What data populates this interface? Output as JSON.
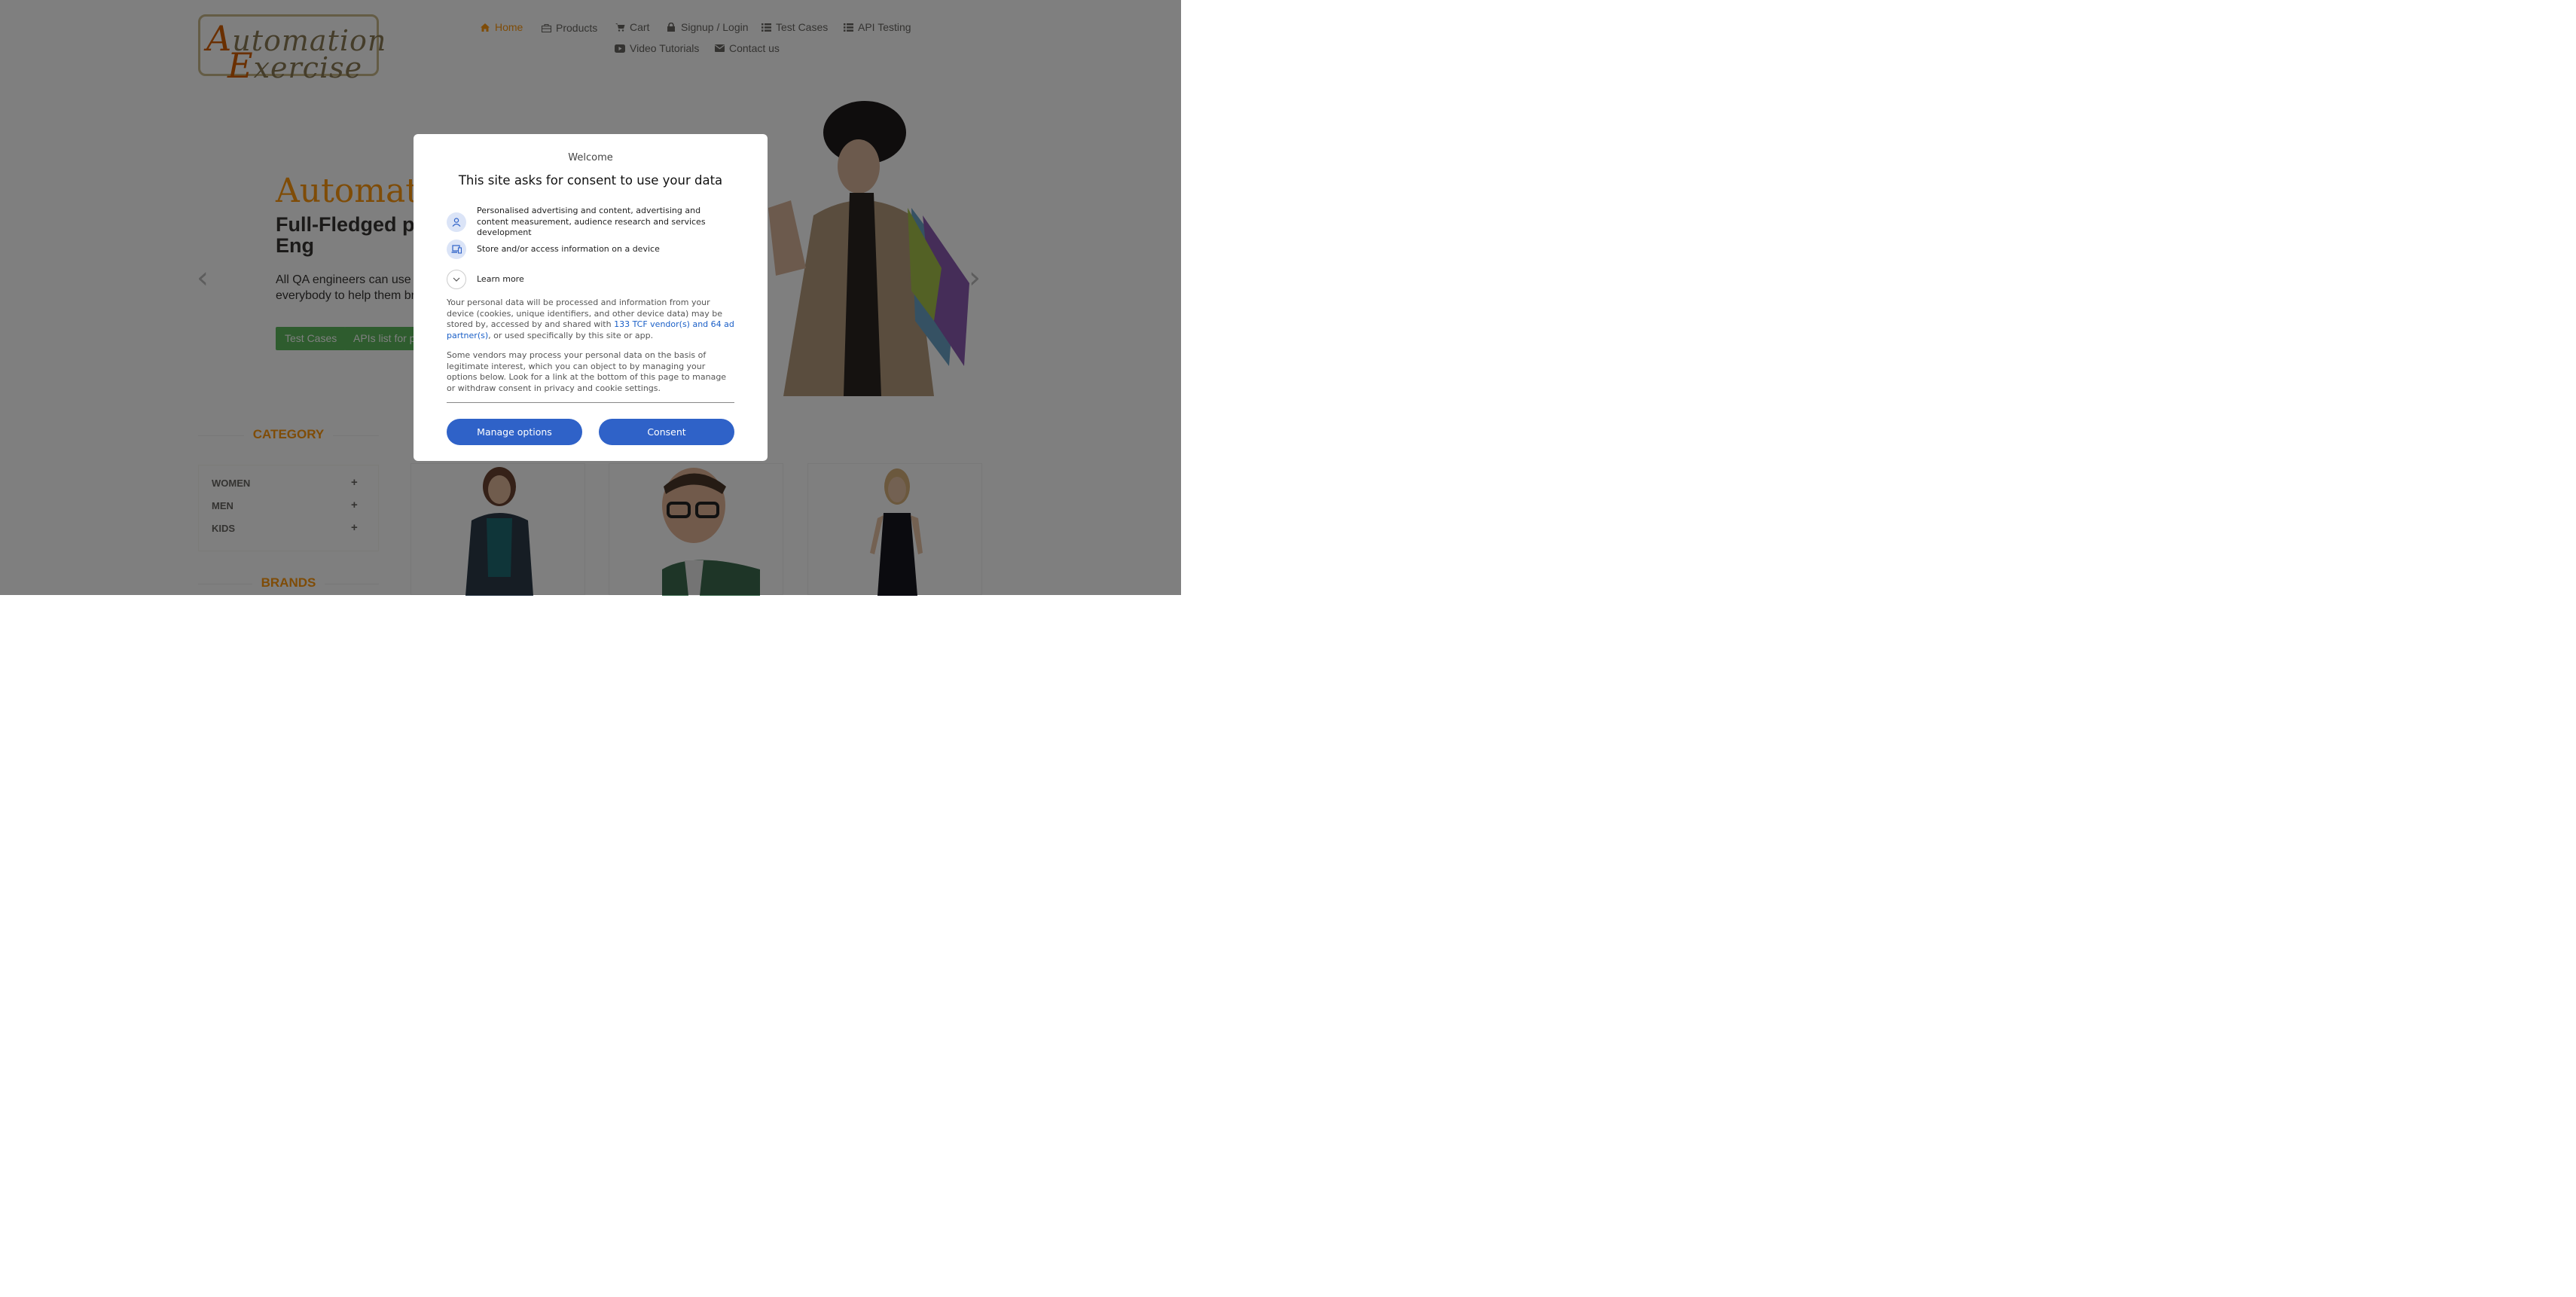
{
  "header": {
    "logo_line1_cap": "A",
    "logo_line1_rest": "utomation",
    "logo_line2_cap": "E",
    "logo_line2_rest": "xercise",
    "nav": [
      {
        "label": "Home",
        "icon": "home-icon",
        "active": true
      },
      {
        "label": "Products",
        "icon": "products-icon"
      },
      {
        "label": "Cart",
        "icon": "cart-icon"
      },
      {
        "label": "Signup / Login",
        "icon": "lock-icon"
      },
      {
        "label": "Test Cases",
        "icon": "list-icon"
      },
      {
        "label": "API Testing",
        "icon": "list-icon"
      },
      {
        "label": "Video Tutorials",
        "icon": "youtube-icon"
      },
      {
        "label": "Contact us",
        "icon": "envelope-icon"
      }
    ]
  },
  "slider": {
    "title": "Automatio",
    "subtitle": "Full-Fledged pra Automation Eng",
    "description": "All QA engineers can use thi API testing either they are at everybody to help them brus",
    "buttons": [
      "Test Cases",
      "APIs list for pr"
    ],
    "prev_arrow": "‹",
    "next_arrow": "›"
  },
  "sidebar": {
    "category_title": "CATEGORY",
    "categories": [
      {
        "label": "WOMEN",
        "toggle": "+"
      },
      {
        "label": "MEN",
        "toggle": "+"
      },
      {
        "label": "KIDS",
        "toggle": "+"
      }
    ],
    "brands_title": "BRANDS"
  },
  "consent": {
    "welcome": "Welcome",
    "title": "This site asks for consent to use your data",
    "purposes": [
      {
        "text": "Personalised advertising and content, advertising and content measurement, audience research and services development",
        "icon": "person-icon"
      },
      {
        "text": "Store and/or access information on a device",
        "icon": "device-icon"
      }
    ],
    "learn_more": "Learn more",
    "para1_before": "Your personal data will be processed and information from your device (cookies, unique identifiers, and other device data) may be stored by, accessed by and shared with ",
    "para1_link": "133 TCF vendor(s) and 64 ad partner(s)",
    "para1_after": ", or used specifically by this site or app.",
    "para2": "Some vendors may process your personal data on the basis of legitimate interest, which you can object to by managing your options below. Look for a link at the bottom of this page to manage or withdraw consent in privacy and cookie settings.",
    "manage_button": "Manage options",
    "consent_button": "Consent"
  },
  "colors": {
    "accent": "#fe980f",
    "green_button": "#5cb85c",
    "consent_blue": "#2f62c8",
    "link_blue": "#1a5fc7"
  }
}
